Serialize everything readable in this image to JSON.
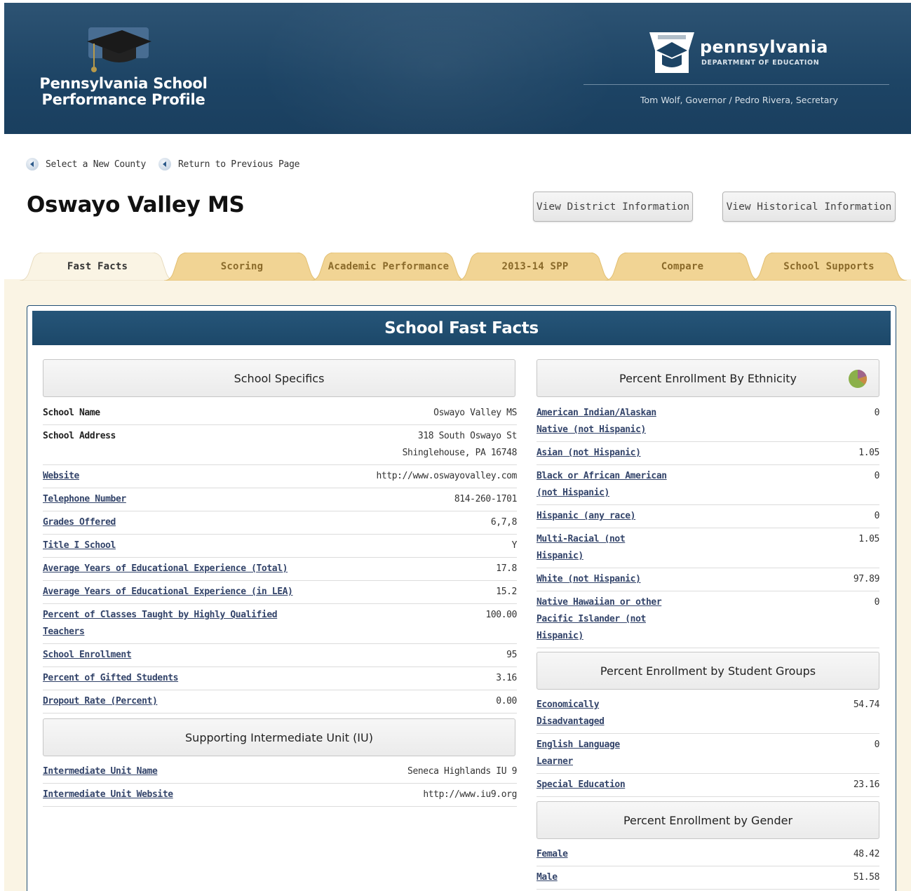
{
  "header": {
    "site_title_line1": "Pennsylvania School",
    "site_title_line2": "Performance Profile",
    "agency_name": "pennsylvania",
    "agency_dept": "DEPARTMENT OF EDUCATION",
    "officials": "Tom Wolf, Governor / Pedro Rivera, Secretary"
  },
  "nav": {
    "back_links": [
      "Select a New County",
      "Return to Previous Page"
    ]
  },
  "page": {
    "title": "Oswayo Valley MS",
    "buttons": {
      "district": "View District Information",
      "historical": "View Historical Information"
    }
  },
  "tabs": [
    {
      "label": "Fast Facts",
      "active": true
    },
    {
      "label": "Scoring",
      "active": false
    },
    {
      "label": "Academic Performance",
      "active": false
    },
    {
      "label": "2013-14 SPP",
      "active": false
    },
    {
      "label": "Compare",
      "active": false
    },
    {
      "label": "School Supports",
      "active": false
    }
  ],
  "panel": {
    "title": "School Fast Facts",
    "school_specifics": {
      "heading": "School Specifics",
      "rows": [
        {
          "label": "School Name",
          "value": "Oswayo Valley MS"
        },
        {
          "label": "School Address",
          "value_line1": "318 South Oswayo St",
          "value_line2": "Shinglehouse, PA 16748"
        },
        {
          "label": "Website",
          "value": "http://www.oswayovalley.com"
        },
        {
          "label": "Telephone Number",
          "value": "814-260-1701"
        },
        {
          "label": "Grades Offered",
          "value": "6,7,8"
        },
        {
          "label": "Title I School",
          "value": "Y"
        },
        {
          "label": "Average Years of Educational Experience (Total)",
          "value": "17.8"
        },
        {
          "label": "Average Years of Educational Experience (in LEA)",
          "value": "15.2"
        },
        {
          "label_line1": "Percent of Classes Taught by Highly Qualified",
          "label_line2": "Teachers",
          "value": "100.00"
        },
        {
          "label": "School Enrollment",
          "value": "95"
        },
        {
          "label": "Percent of Gifted Students",
          "value": "3.16"
        },
        {
          "label": "Dropout Rate (Percent)",
          "value": "0.00"
        }
      ]
    },
    "iu": {
      "heading": "Supporting Intermediate Unit (IU)",
      "rows": [
        {
          "label": "Intermediate Unit Name",
          "value": "Seneca Highlands IU 9"
        },
        {
          "label": "Intermediate Unit Website",
          "value": "http://www.iu9.org"
        }
      ]
    },
    "ethnicity": {
      "heading": "Percent Enrollment By Ethnicity",
      "icon": "pie-chart-icon",
      "rows": [
        {
          "label_line1": "American Indian/Alaskan",
          "label_line2": "Native (not Hispanic)",
          "value": "0"
        },
        {
          "label_line1": "Asian (not Hispanic)",
          "value": "1.05"
        },
        {
          "label_line1": "Black or African American",
          "label_line2": "(not Hispanic)",
          "value": "0"
        },
        {
          "label_line1": "Hispanic (any race)",
          "value": "0"
        },
        {
          "label_line1": "Multi-Racial (not",
          "label_line2": "Hispanic)",
          "value": "1.05"
        },
        {
          "label_line1": "White (not Hispanic)",
          "value": "97.89"
        },
        {
          "label_line1": "Native Hawaiian or other",
          "label_line2": "Pacific Islander (not",
          "label_line3": "Hispanic)",
          "value": "0"
        }
      ]
    },
    "student_groups": {
      "heading": "Percent Enrollment by Student Groups",
      "rows": [
        {
          "label_line1": "Economically",
          "label_line2": "Disadvantaged",
          "value": "54.74"
        },
        {
          "label_line1": "English Language",
          "label_line2": "Learner",
          "value": "0"
        },
        {
          "label_line1": "Special Education",
          "value": "23.16"
        }
      ]
    },
    "gender": {
      "heading": "Percent Enrollment by Gender",
      "rows": [
        {
          "label": "Female",
          "value": "48.42"
        },
        {
          "label": "Male",
          "value": "51.58"
        }
      ]
    }
  },
  "colors": {
    "header_bg": "#1d4465",
    "panel_header_bg": "#1c4869",
    "tab_inactive": "#f1d494",
    "tab_active": "#faf4e4",
    "link": "#33446a"
  }
}
